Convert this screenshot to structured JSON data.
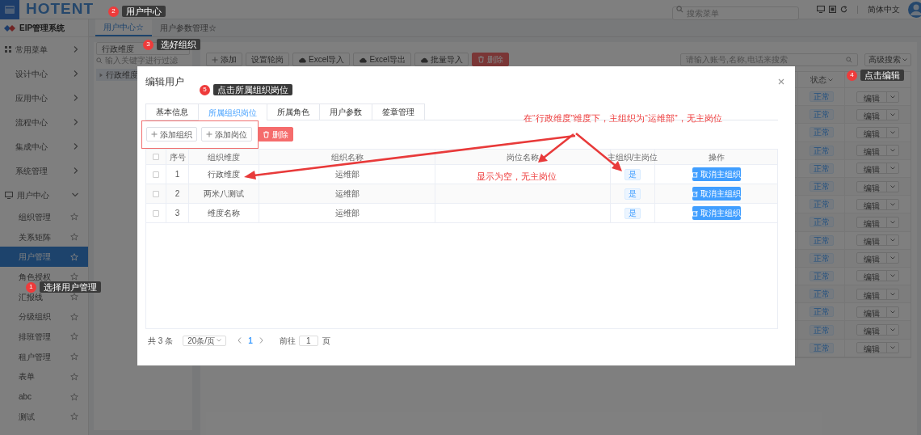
{
  "header": {
    "logo": "HOTENT",
    "search_placeholder": "搜索菜单",
    "language": "简体中文"
  },
  "sidebar": {
    "title": "EIP管理系统",
    "items": [
      {
        "label": "常用菜单",
        "expanded": false
      },
      {
        "label": "设计中心",
        "expanded": false
      },
      {
        "label": "应用中心",
        "expanded": false
      },
      {
        "label": "流程中心",
        "expanded": false
      },
      {
        "label": "集成中心",
        "expanded": false
      },
      {
        "label": "系统管理",
        "expanded": false
      },
      {
        "label": "用户中心",
        "expanded": true,
        "children": [
          {
            "label": "组织管理",
            "selected": false
          },
          {
            "label": "关系矩阵",
            "selected": false
          },
          {
            "label": "用户管理",
            "selected": true
          },
          {
            "label": "角色授权",
            "selected": false
          },
          {
            "label": "汇报线",
            "selected": false
          },
          {
            "label": "分级组织",
            "selected": false
          },
          {
            "label": "排班管理",
            "selected": false
          },
          {
            "label": "租户管理",
            "selected": false
          },
          {
            "label": "表单",
            "selected": false
          },
          {
            "label": "abc",
            "selected": false
          },
          {
            "label": "测试",
            "selected": false
          }
        ]
      }
    ]
  },
  "page_tabs": [
    {
      "label": "用户中心☆",
      "selected": true
    },
    {
      "label": "用户参数管理☆",
      "selected": false
    }
  ],
  "tree_panel": {
    "dimension": "行政维度",
    "filter_placeholder": "输入关键字进行过滤",
    "nodes": [
      {
        "label": "行政维度",
        "selected": true
      }
    ]
  },
  "toolbar": [
    {
      "label": "添加",
      "kind": "add"
    },
    {
      "label": "设置轮岗",
      "kind": "plain"
    },
    {
      "label": "Excel导入",
      "kind": "cloud"
    },
    {
      "label": "Excel导出",
      "kind": "cloud"
    },
    {
      "label": "批量导入",
      "kind": "cloud"
    },
    {
      "label": "删除",
      "kind": "danger"
    }
  ],
  "user_search": {
    "placeholder": "请输入账号,名称,电话来搜索",
    "advanced": "高级搜索"
  },
  "user_table": {
    "status_header": "状态",
    "rows": [
      {
        "status": "正常",
        "action": "编辑"
      },
      {
        "status": "正常",
        "action": "编辑"
      },
      {
        "status": "正常",
        "action": "编辑"
      },
      {
        "status": "正常",
        "action": "编辑"
      },
      {
        "status": "正常",
        "action": "编辑"
      },
      {
        "status": "正常",
        "action": "编辑"
      },
      {
        "status": "正常",
        "action": "编辑"
      },
      {
        "status": "正常",
        "action": "编辑"
      },
      {
        "status": "正常",
        "action": "编辑"
      },
      {
        "status": "正常",
        "action": "编辑"
      },
      {
        "status": "正常",
        "action": "编辑"
      },
      {
        "status": "正常",
        "action": "编辑"
      },
      {
        "status": "正常",
        "action": "编辑"
      },
      {
        "status": "正常",
        "action": "编辑"
      },
      {
        "status": "正常",
        "action": "编辑"
      }
    ]
  },
  "modal": {
    "title": "编辑用户",
    "tabs": [
      {
        "label": "基本信息",
        "selected": false
      },
      {
        "label": "所属组织岗位",
        "selected": true
      },
      {
        "label": "所属角色",
        "selected": false
      },
      {
        "label": "用户参数",
        "selected": false
      },
      {
        "label": "签章管理",
        "selected": false
      }
    ],
    "buttons": [
      {
        "label": "添加组织",
        "kind": "add"
      },
      {
        "label": "添加岗位",
        "kind": "add"
      },
      {
        "label": "删除",
        "kind": "danger"
      }
    ],
    "all_checked": false,
    "columns": [
      "序号",
      "组织维度",
      "组织名称",
      "岗位名称",
      "主组织/主岗位",
      "操作"
    ],
    "rows": [
      {
        "checked": false,
        "index": "1",
        "dimension": "行政维度",
        "org": "运维部",
        "main": "是",
        "action": "取消主组织"
      },
      {
        "checked": false,
        "index": "2",
        "dimension": "两米八测试",
        "org": "运维部",
        "main": "是",
        "action": "取消主组织"
      },
      {
        "checked": false,
        "index": "3",
        "dimension": "维度名称",
        "org": "运维部",
        "main": "是",
        "action": "取消主组织"
      }
    ],
    "pagination": {
      "total": "共 3 条",
      "page_size": "20条/页",
      "pages": [
        {
          "label": "1",
          "selected": true
        }
      ],
      "goto_label": "前往",
      "goto_value": "1",
      "goto_suffix": "页"
    }
  },
  "annotations": {
    "steps": [
      {
        "number": "1",
        "text": "选择用户管理"
      },
      {
        "number": "2",
        "text": "用户中心"
      },
      {
        "number": "3",
        "text": "选好组织"
      },
      {
        "number": "4",
        "text": "点击编辑"
      },
      {
        "number": "5",
        "text": "点击所属组织岗位"
      }
    ],
    "notes": [
      "在“行政维度”维度下，主组织为“运维部”，无主岗位",
      "显示为空，无主岗位"
    ]
  }
}
